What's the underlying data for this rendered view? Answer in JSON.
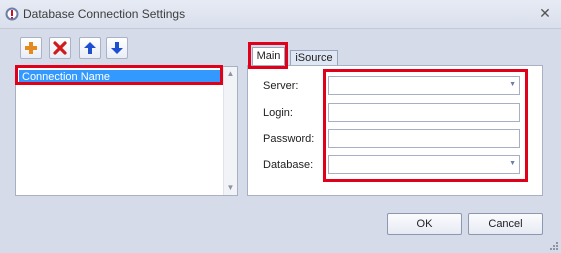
{
  "window": {
    "title": "Database Connection Settings"
  },
  "toolbar": {
    "add_icon": "plus-icon",
    "delete_icon": "delete-x-icon",
    "up_icon": "arrow-up-icon",
    "down_icon": "arrow-down-icon"
  },
  "connections": {
    "items": [
      {
        "label": "Connection Name",
        "selected": true
      }
    ]
  },
  "tabs": [
    {
      "label": "Main",
      "active": true
    },
    {
      "label": "iSource",
      "active": false
    }
  ],
  "form": {
    "server_label": "Server:",
    "login_label": "Login:",
    "password_label": "Password:",
    "database_label": "Database:",
    "server_value": "",
    "login_value": "",
    "password_value": "",
    "database_value": ""
  },
  "buttons": {
    "ok": "OK",
    "cancel": "Cancel"
  },
  "colors": {
    "highlight": "#e1001a",
    "selection": "#3399ff",
    "window_bg": "#d6dbe9"
  }
}
